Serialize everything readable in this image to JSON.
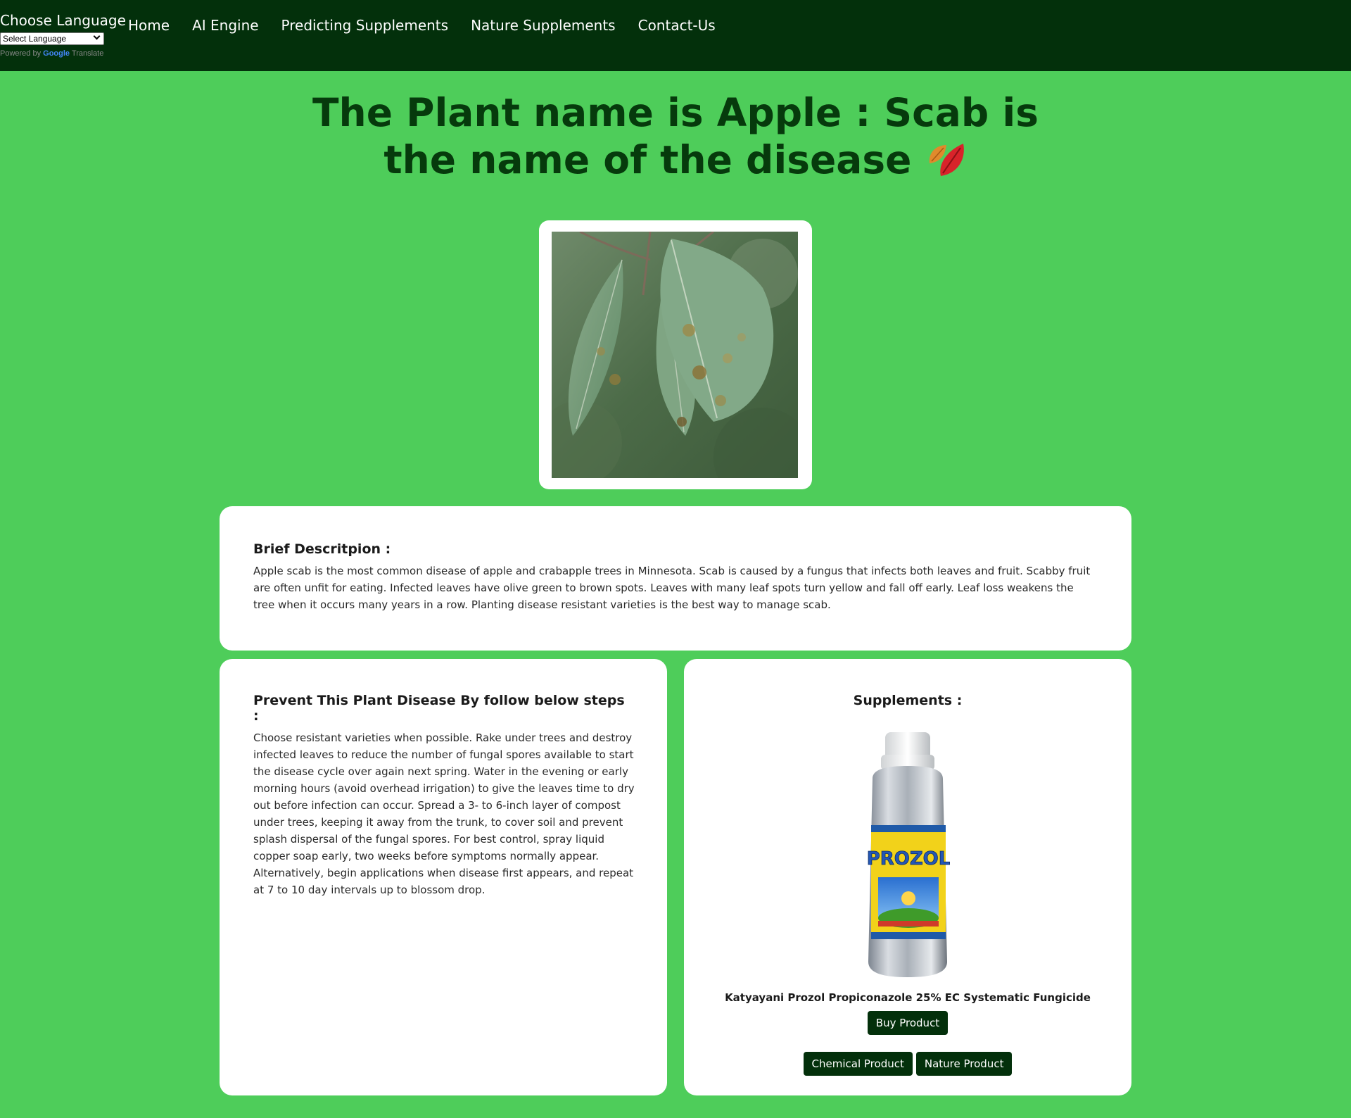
{
  "nav": {
    "choose_language": "Choose Language",
    "select_value": "Select Language",
    "powered_prefix": "Powered by",
    "powered_google": "Google",
    "powered_translate": "Translate",
    "links": [
      "Home",
      "AI Engine",
      "Predicting Supplements",
      "Nature Supplements",
      "Contact-Us"
    ]
  },
  "heading": {
    "text": "The Plant name is Apple : Scab is the name of the disease"
  },
  "description": {
    "title": "Brief Descritpion :",
    "text": "Apple scab is the most common disease of apple and crabapple trees in Minnesota. Scab is caused by a fungus that infects both leaves and fruit. Scabby fruit are often unfit for eating. Infected leaves have olive green to brown spots. Leaves with many leaf spots turn yellow and fall off early. Leaf loss weakens the tree when it occurs many years in a row. Planting disease resistant varieties is the best way to manage scab."
  },
  "prevent": {
    "title": "Prevent This Plant Disease By follow below steps :",
    "text": "Choose resistant varieties when possible. Rake under trees and destroy infected leaves to reduce the number of fungal spores available to start the disease cycle over again next spring. Water in the evening or early morning hours (avoid overhead irrigation) to give the leaves time to dry out before infection can occur. Spread a 3- to 6-inch layer of compost under trees, keeping it away from the trunk, to cover soil and prevent splash dispersal of the fungal spores. For best control, spray liquid copper soap early, two weeks before symptoms normally appear. Alternatively, begin applications when disease first appears, and repeat at 7 to 10 day intervals up to blossom drop."
  },
  "supplements": {
    "title": "Supplements :",
    "bottle_label": "PROZOL",
    "product_name": "Katyayani Prozol Propiconazole 25% EC Systematic Fungicide",
    "buy_label": "Buy Product",
    "chemical_label": "Chemical Product",
    "nature_label": "Nature Product"
  },
  "colors": {
    "page_bg": "#4ecd5a",
    "nav_bg": "#03300b",
    "heading": "#063a0c",
    "button_bg": "#03300b"
  }
}
